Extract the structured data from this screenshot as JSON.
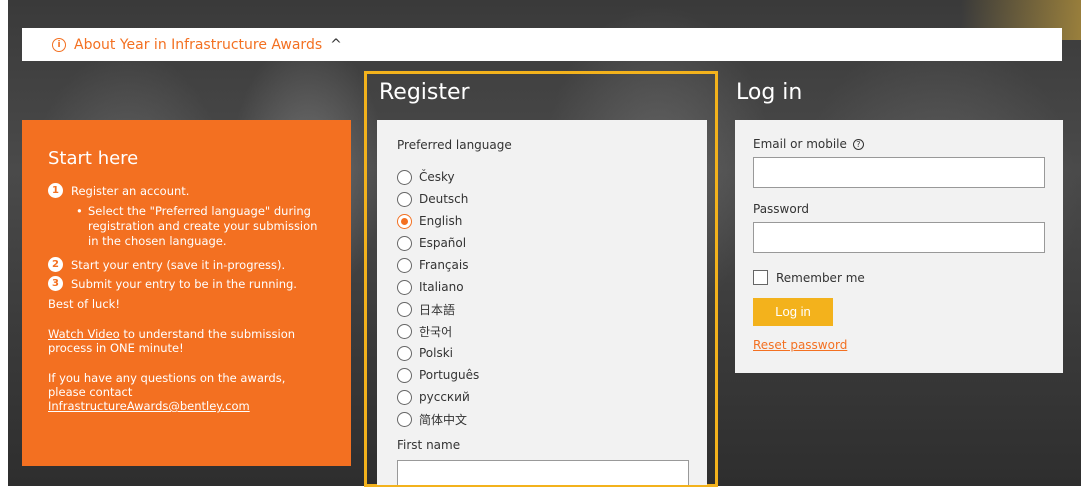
{
  "about": {
    "info_icon": "i",
    "label": "About Year in Infrastructure Awards",
    "chevron": "^"
  },
  "start": {
    "title": "Start here",
    "steps": [
      {
        "num": "1",
        "text": "Register an account."
      },
      {
        "num": "2",
        "text": "Start your entry (save it in-progress)."
      },
      {
        "num": "3",
        "text": "Submit your entry to be in the running."
      }
    ],
    "sub_bullet": "Select the \"Preferred language\" during registration and create your submission in the chosen language.",
    "luck": "Best of luck!",
    "video_link": "Watch Video",
    "video_rest": " to understand the submission process in ONE minute!",
    "contact_text": "If you have any questions on the awards, please contact",
    "contact_email": "InfrastructureAwards@bentley.com"
  },
  "register": {
    "title": "Register",
    "pref_lang_label": "Preferred language",
    "languages": [
      "Česky",
      "Deutsch",
      "English",
      "Español",
      "Français",
      "Italiano",
      "日本語",
      "한국어",
      "Polski",
      "Português",
      "русский",
      "简体中文"
    ],
    "selected_language": "English",
    "first_name_label": "First name"
  },
  "login": {
    "title": "Log in",
    "email_label": "Email or mobile",
    "help_icon": "?",
    "password_label": "Password",
    "remember_label": "Remember me",
    "login_button": "Log in",
    "reset_link": "Reset password"
  },
  "colors": {
    "orange": "#f37021",
    "gold": "#f3b21c"
  }
}
